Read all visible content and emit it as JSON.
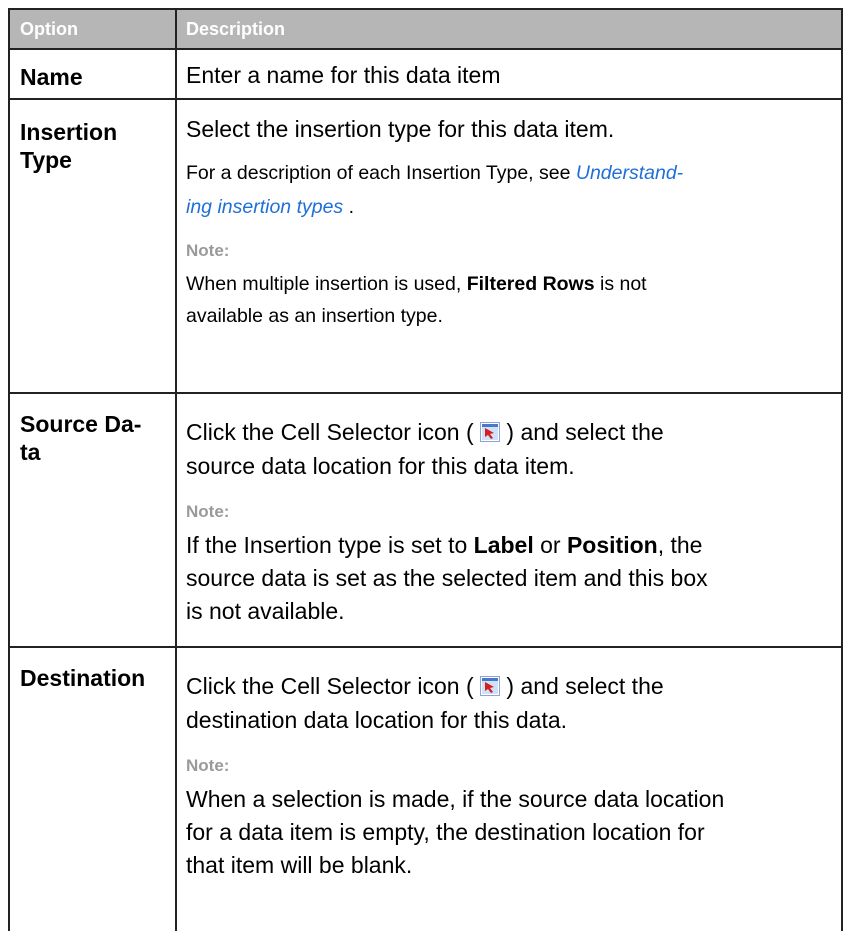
{
  "header": {
    "option": "Option",
    "description": "Description"
  },
  "rows": [
    {
      "option": "Name",
      "desc": "Enter a name for this data item"
    },
    {
      "option_line1": "Insertion",
      "option_line2": "Type",
      "desc": "Select the insertion type for this data item.",
      "ref_pre": "For a description of each Insertion Type, see ",
      "ref_link_line1": "Understand-",
      "ref_link_line2": "ing insertion types",
      "ref_post": " .",
      "note_label": "Note:",
      "note_pre": "When multiple insertion is used, ",
      "note_bold": "Filtered Rows",
      "note_post": " is not",
      "note_line2": "available as an insertion type."
    },
    {
      "option_line1": "Source Da-",
      "option_line2": "ta",
      "desc_pre": "Click the Cell Selector icon ( ",
      "desc_post": " ) and select the",
      "desc_line2": "source data location for this data item.",
      "note_label": "Note:",
      "note_pre": "If the Insertion type is set to ",
      "note_bold1": "Label",
      "note_mid": " or ",
      "note_bold2": "Position",
      "note_post": ", the",
      "note_line2": "source data is set as the selected item and this box",
      "note_line3": "is not available."
    },
    {
      "option": "Destination",
      "desc_pre": "Click the Cell Selector icon ( ",
      "desc_post": " ) and select the",
      "desc_line2": "destination data location for this data.",
      "note_label": "Note:",
      "note_line1": "When a selection is made, if the source data location",
      "note_line2": "for a data item is empty, the destination location for",
      "note_line3": "that item will be blank."
    }
  ],
  "icon": "cell-selector-icon"
}
